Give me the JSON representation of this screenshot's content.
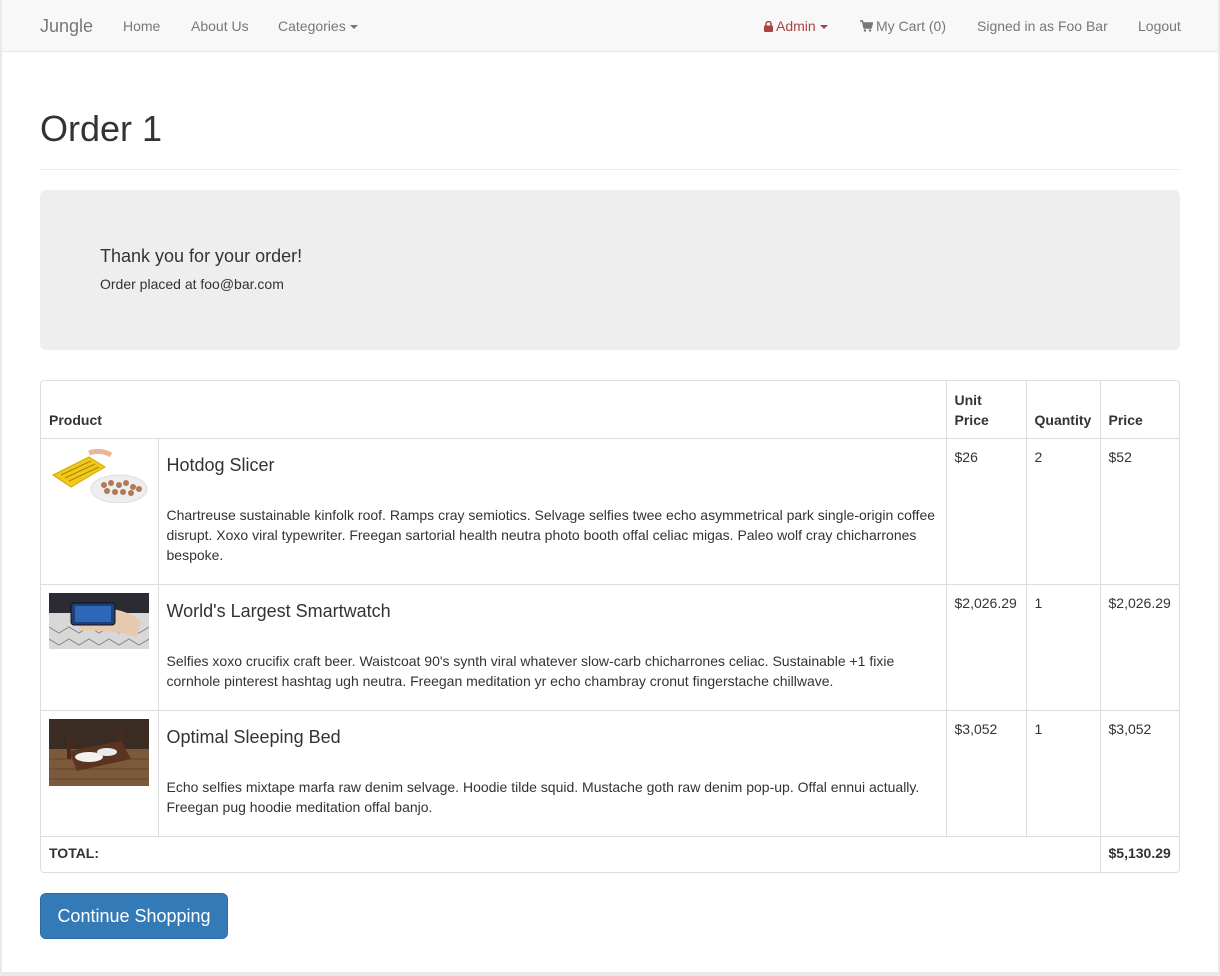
{
  "navbar": {
    "brand": "Jungle",
    "home": "Home",
    "about": "About Us",
    "categories": "Categories",
    "admin": "Admin",
    "cart": "My Cart (0)",
    "signed_in": "Signed in as Foo Bar",
    "logout": "Logout"
  },
  "page": {
    "title": "Order 1"
  },
  "jumbotron": {
    "thanks": "Thank you for your order!",
    "placed": "Order placed at foo@bar.com"
  },
  "table": {
    "headers": {
      "product": "Product",
      "unit_price": "Unit Price",
      "quantity": "Quantity",
      "price": "Price"
    },
    "rows": [
      {
        "name": "Hotdog Slicer",
        "description": "Chartreuse sustainable kinfolk roof. Ramps cray semiotics. Selvage selfies twee echo asymmetrical park single-origin coffee disrupt. Xoxo viral typewriter. Freegan sartorial health neutra photo booth offal celiac migas. Paleo wolf cray chicharrones bespoke.",
        "unit_price": "$26",
        "quantity": "2",
        "price": "$52"
      },
      {
        "name": "World's Largest Smartwatch",
        "description": "Selfies xoxo crucifix craft beer. Waistcoat 90's synth viral whatever slow-carb chicharrones celiac. Sustainable +1 fixie cornhole pinterest hashtag ugh neutra. Freegan meditation yr echo chambray cronut fingerstache chillwave.",
        "unit_price": "$2,026.29",
        "quantity": "1",
        "price": "$2,026.29"
      },
      {
        "name": "Optimal Sleeping Bed",
        "description": "Echo selfies mixtape marfa raw denim selvage. Hoodie tilde squid. Mustache goth raw denim pop-up. Offal ennui actually. Freegan pug hoodie meditation offal banjo.",
        "unit_price": "$3,052",
        "quantity": "1",
        "price": "$3,052"
      }
    ],
    "total_label": "TOTAL:",
    "total_value": "$5,130.29"
  },
  "actions": {
    "continue": "Continue Shopping"
  },
  "colors": {
    "primary": "#337ab7",
    "admin": "#a94442",
    "navbar_bg": "#f8f8f8",
    "jumbotron_bg": "#eeeeee"
  }
}
